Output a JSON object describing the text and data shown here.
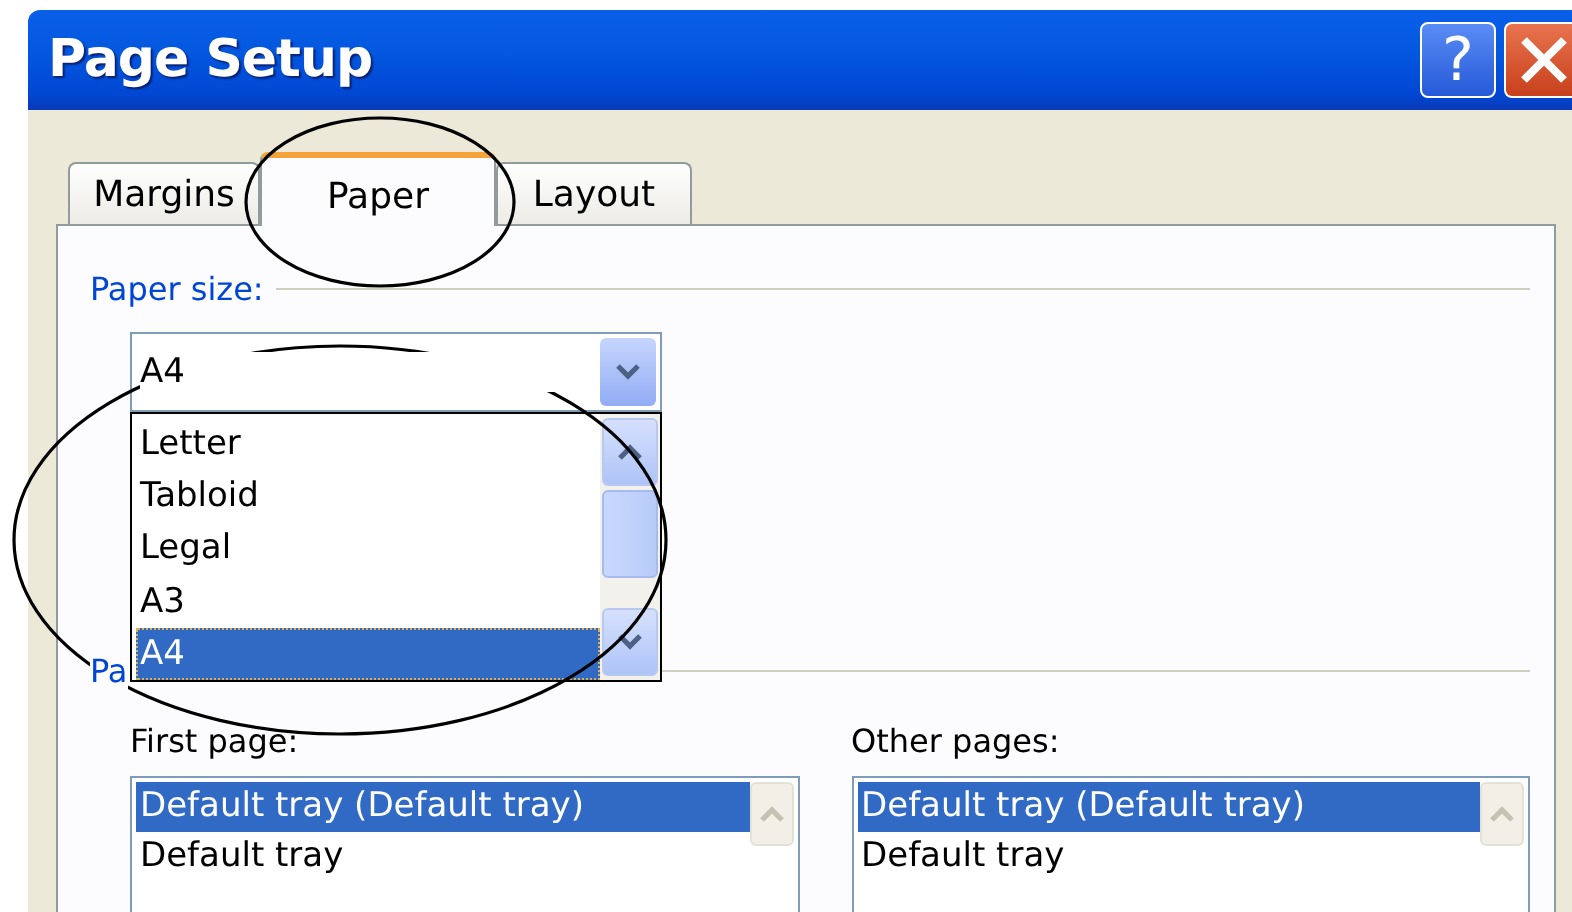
{
  "window": {
    "title": "Page Setup",
    "help_label": "?"
  },
  "tabs": [
    {
      "label": "Margins",
      "selected": false
    },
    {
      "label": "Paper",
      "selected": true
    },
    {
      "label": "Layout",
      "selected": false
    }
  ],
  "paper_size": {
    "label": "Paper size:",
    "value": "A4",
    "expanded": true,
    "options": [
      {
        "label": "Letter",
        "selected": false
      },
      {
        "label": "Tabloid",
        "selected": false
      },
      {
        "label": "Legal",
        "selected": false
      },
      {
        "label": "A3",
        "selected": false
      },
      {
        "label": "A4",
        "selected": true
      }
    ]
  },
  "paper_source": {
    "label": "Pa",
    "lists": [
      {
        "label": "First page:",
        "items": [
          {
            "label": "Default tray (Default tray)",
            "selected": true
          },
          {
            "label": "Default tray",
            "selected": false
          }
        ]
      },
      {
        "label": "Other pages:",
        "items": [
          {
            "label": "Default tray (Default tray)",
            "selected": true
          },
          {
            "label": "Default tray",
            "selected": false
          }
        ]
      }
    ]
  }
}
